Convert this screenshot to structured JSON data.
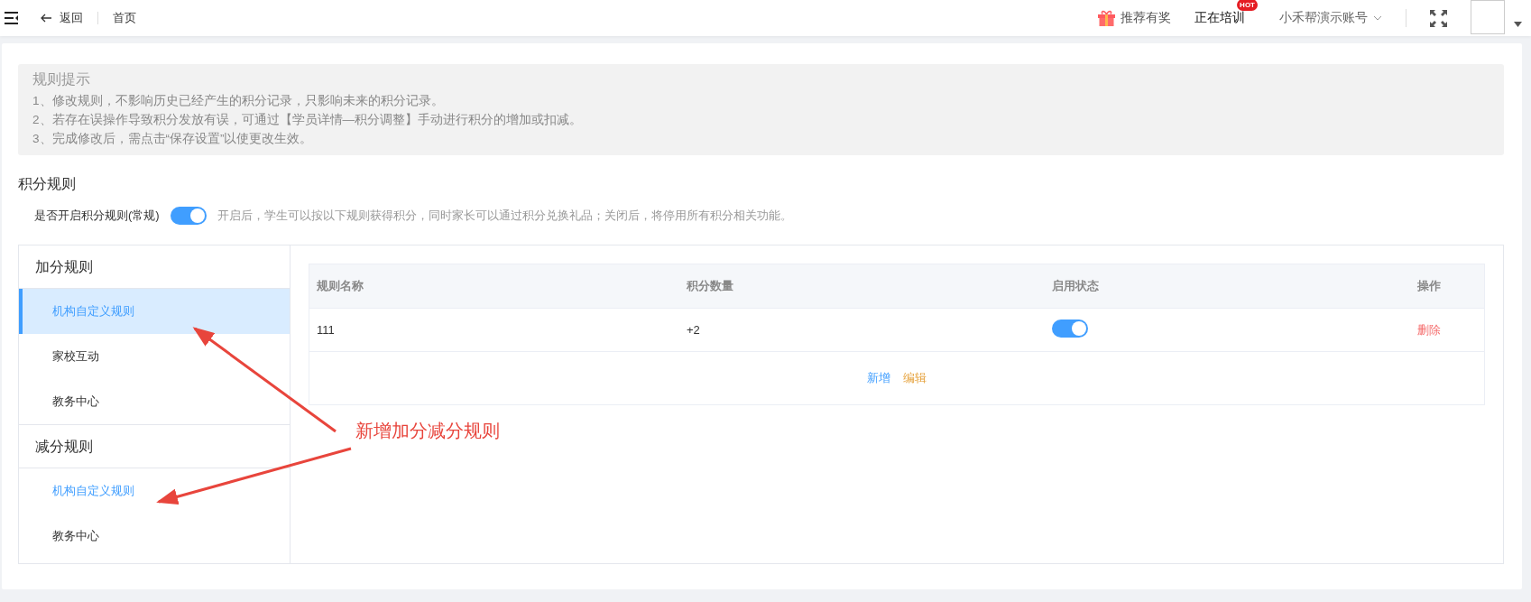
{
  "topbar": {
    "back": "返回",
    "breadcrumb": "首页",
    "referral": "推荐有奖",
    "training": "正在培训",
    "hot_badge": "HOT",
    "account": "小禾帮演示账号"
  },
  "tips": {
    "title": "规则提示",
    "lines": [
      "1、修改规则，不影响历史已经产生的积分记录，只影响未来的积分记录。",
      "2、若存在误操作导致积分发放有误，可通过【学员详情—积分调整】手动进行积分的增加或扣减。",
      "3、完成修改后，需点击“保存设置”以使更改生效。"
    ]
  },
  "section_title": "积分规则",
  "switch_row": {
    "label": "是否开启积分规则(常规)",
    "on": true,
    "hint": "开启后，学生可以按以下规则获得积分，同时家长可以通过积分兑换礼品；关闭后，将停用所有积分相关功能。"
  },
  "sidebar": {
    "groups": [
      {
        "title": "加分规则",
        "items": [
          {
            "label": "机构自定义规则",
            "selected": true,
            "active": true
          },
          {
            "label": "家校互动",
            "selected": false,
            "active": false
          },
          {
            "label": "教务中心",
            "selected": false,
            "active": false
          }
        ]
      },
      {
        "title": "减分规则",
        "items": [
          {
            "label": "机构自定义规则",
            "selected": false,
            "active": true
          },
          {
            "label": "教务中心",
            "selected": false,
            "active": false
          }
        ]
      }
    ]
  },
  "table": {
    "columns": [
      "规则名称",
      "积分数量",
      "启用状态",
      "操作"
    ],
    "rows": [
      {
        "name": "111",
        "points": "+2",
        "enabled": true,
        "action": "删除"
      }
    ],
    "footer_links": [
      {
        "label": "新增",
        "kind": "add"
      },
      {
        "label": "编辑",
        "kind": "edit"
      }
    ]
  },
  "annotation": "新增加分减分规则"
}
